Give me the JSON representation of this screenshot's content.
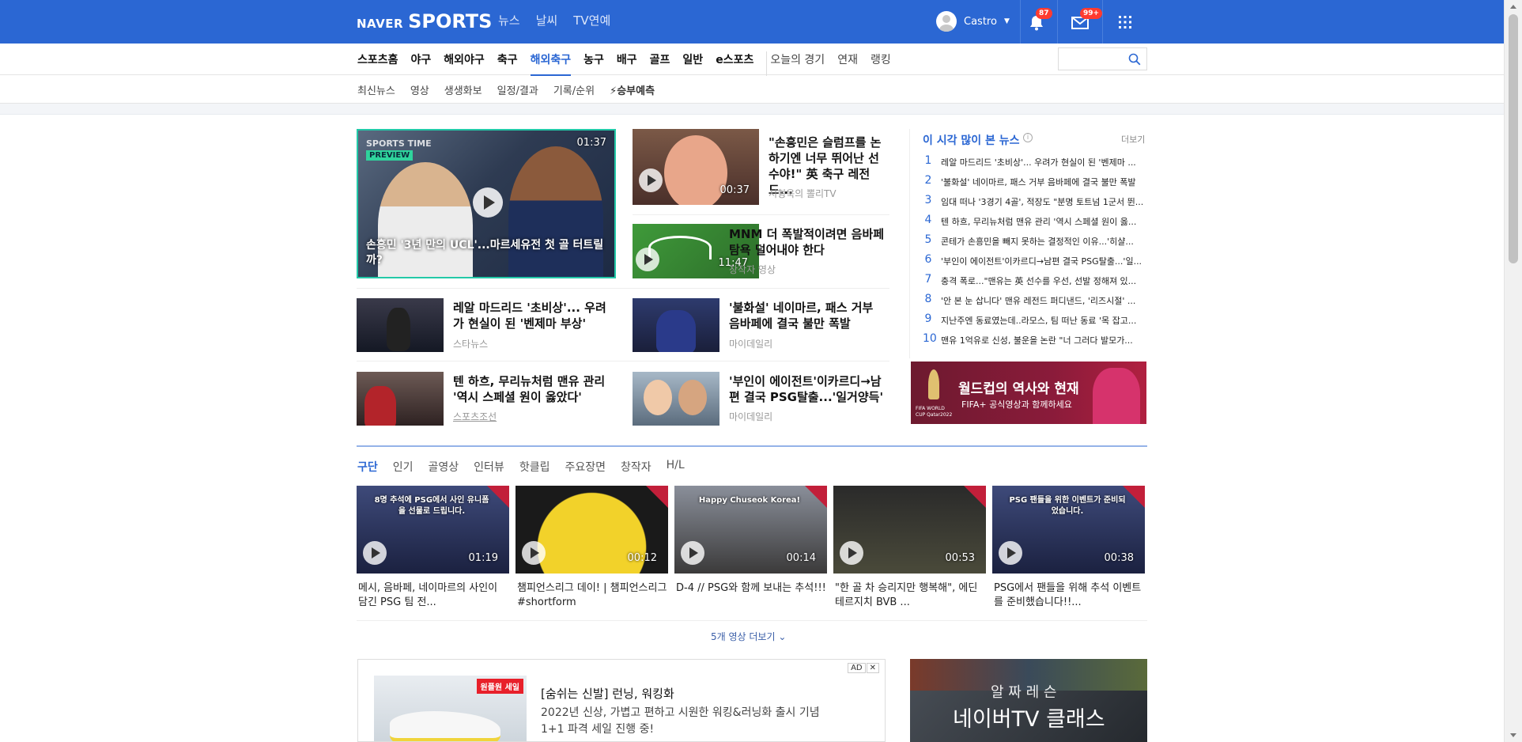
{
  "header": {
    "logo_naver": "NAVER",
    "logo_sports": "SPORTS",
    "nav": [
      "뉴스",
      "날씨",
      "TV연예"
    ],
    "user_name": "Castro",
    "notif_count": "87",
    "mail_count": "99+"
  },
  "menu": {
    "items": [
      "스포츠홈",
      "야구",
      "해외야구",
      "축구",
      "해외축구",
      "농구",
      "배구",
      "골프",
      "일반",
      "e스포츠"
    ],
    "secondary": [
      "오늘의 경기",
      "연재",
      "랭킹"
    ],
    "active": "해외축구",
    "search_placeholder": ""
  },
  "submenu": [
    "최신뉴스",
    "영상",
    "생생화보",
    "일정/결과",
    "기록/순위",
    "⚡승부예측"
  ],
  "main": {
    "hero": {
      "badge_top": "SPORTS TIME",
      "badge_preview": "PREVIEW",
      "duration": "01:37",
      "title": "손흥민 '3년 만의 UCL'...마르세유전 첫 골 터트릴까?"
    },
    "side_videos": [
      {
        "title": "\"손흥민은 슬럼프를 논하기엔 너무 뛰어난 선수야!\" 英 축구 레전드...",
        "source": "서형욱의 뽈리TV",
        "duration": "00:37"
      },
      {
        "title": "MNM 더 폭발적이려면 음바페 탐욕 덜어내야 한다",
        "source": "창작자 영상",
        "duration": "11:47"
      }
    ],
    "news": [
      {
        "title": "레알 마드리드 '초비상'... 우려가 현실이 된 '벤제마 부상'",
        "source": "스타뉴스"
      },
      {
        "title": "'불화설' 네이마르, 패스 거부 음바페에 결국 불만 폭발",
        "source": "마이데일리"
      },
      {
        "title": "텐 하흐, 무리뉴처럼 맨유 관리 '역시 스페셜 원이 옳았다'",
        "source": "스포츠조선"
      },
      {
        "title": "'부인이 에이전트'이카르디→남편 결국 PSG탈출...'일거양득'",
        "source": "마이데일리"
      }
    ]
  },
  "ranking": {
    "title": "이 시각 많이 본 뉴스",
    "more": "더보기",
    "items": [
      "레알 마드리드 '초비상'... 우려가 현실이 된 '벤제마 ...",
      "'불화설' 네이마르, 패스 거부 음바페에 결국 불만 폭발",
      "임대 떠나 '3경기 4골', 적장도 \"분명 토트넘 1군서 뛴...",
      "텐 하흐, 무리뉴처럼 맨유 관리 '역시 스페셜 원이 옳...",
      "콘테가 손흥민을 빼지 못하는 결정적인 이유...'히샬...",
      "'부인이 에이전트'이카르디→남편 결국 PSG탈출...'일...",
      "충격 폭로...\"맨유는 英 선수를 우선, 선발 정해져 있...",
      "'안 본 눈 삽니다' 맨유 레전드 퍼디낸드, '리즈시절' ...",
      "지난주엔 동료였는데..라모스, 팀 떠난 동료 '목 잡고...",
      "맨유 1억유로 신성, 불운을 논란 \"너 그러다 발모가..."
    ]
  },
  "banner": {
    "title": "월드컵의 역사와 현재",
    "sub": "FIFA+ 공식영상과 함께하세요",
    "logo_text": "FIFA WORLD CUP Qatar2022"
  },
  "videos": {
    "tabs": [
      "구단",
      "인기",
      "골영상",
      "인터뷰",
      "핫클립",
      "주요장면",
      "창작자",
      "H/L"
    ],
    "active_tab": "구단",
    "items": [
      {
        "caption": "메시, 음바페, 네이마르의 사인이 담긴 PSG 팀 전...",
        "duration": "01:19",
        "overlay": "8명 추석에 PSG에서 사인 유니폼을 선물로 드립니다."
      },
      {
        "caption": "챔피언스리그 데이! | 챔피언스리그 #shortform",
        "duration": "00:12",
        "overlay": ""
      },
      {
        "caption": "D-4 // PSG와 함께 보내는 추석!!!",
        "duration": "00:14",
        "overlay": "Happy Chuseok Korea!"
      },
      {
        "caption": "\"한 골 차 승리지만 행복해\", 에딘 테르지치 BVB ...",
        "duration": "00:53",
        "overlay": ""
      },
      {
        "caption": "PSG에서 팬들을 위해 추석 이벤트를 준비했습니다!!...",
        "duration": "00:38",
        "overlay": "PSG 팬들을 위한 이벤트가 준비되었습니다."
      }
    ],
    "more": "5개 영상 더보기"
  },
  "ad": {
    "tag": "AD",
    "close": "✕",
    "sale_badge": "원플원 세일",
    "title": "[숨쉬는 신발] 런닝, 워킹화",
    "desc": "2022년 신상, 가볍고 편하고 시원한 워킹&러닝화 출시 기념 1+1 파격 세일 진행 중!"
  },
  "naver_tv": {
    "small": "알 짜 레 슨",
    "big": "네이버TV 클래스"
  },
  "colors": {
    "brand": "#2b67d3",
    "badge": "#ff3b2f"
  }
}
